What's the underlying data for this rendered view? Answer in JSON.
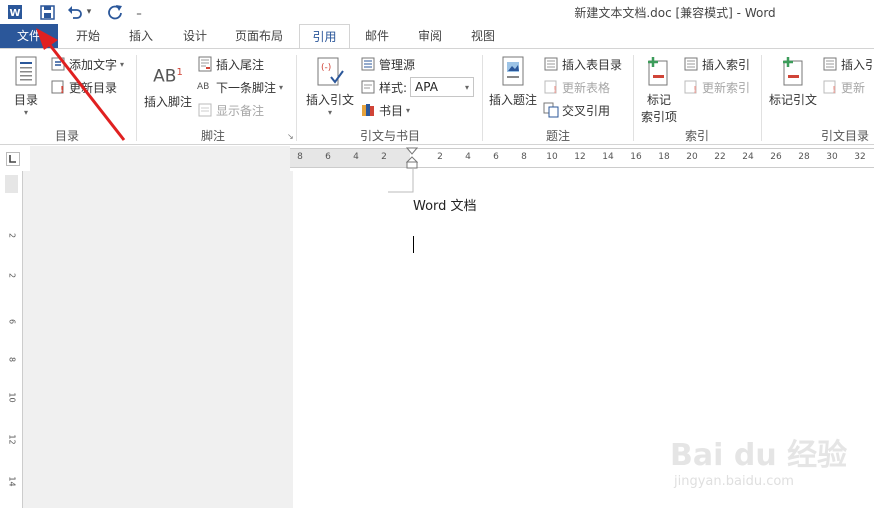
{
  "window": {
    "title": "新建文本文档.doc [兼容模式] - Word"
  },
  "qat": {
    "app_icon": "word-icon",
    "save_icon": "save-icon",
    "undo_icon": "undo-icon",
    "undo_caret": "▾",
    "redo_icon": "redo-icon",
    "customize": "₌"
  },
  "tabs": [
    {
      "label": "文件"
    },
    {
      "label": "开始"
    },
    {
      "label": "插入"
    },
    {
      "label": "设计"
    },
    {
      "label": "页面布局"
    },
    {
      "label": "引用"
    },
    {
      "label": "邮件"
    },
    {
      "label": "审阅"
    },
    {
      "label": "视图"
    }
  ],
  "ribbon": {
    "toc": {
      "big_label": "目录",
      "add_text": "添加文字",
      "update": "更新目录",
      "group": "目录"
    },
    "footnotes": {
      "big_label": "插入脚注",
      "big_glyph": "AB",
      "big_sup": "1",
      "endnote": "插入尾注",
      "next": "下一条脚注",
      "next_glyph": "AB",
      "show": "显示备注",
      "group": "脚注"
    },
    "citations": {
      "big_label": "插入引文",
      "manage": "管理源",
      "style_label": "样式:",
      "style_value": "APA",
      "bibliography": "书目",
      "group": "引文与书目"
    },
    "captions": {
      "big_label": "插入题注",
      "table_of_figures": "插入表目录",
      "update_table": "更新表格",
      "cross_ref": "交叉引用",
      "group": "题注"
    },
    "index": {
      "big_label_1": "标记",
      "big_label_2": "索引项",
      "insert_index": "插入索引",
      "update_index": "更新索引",
      "group": "索引"
    },
    "toa": {
      "big_label": "标记引文",
      "insert": "插入引",
      "update": "更新",
      "group": "引文目录"
    }
  },
  "ruler": {
    "ticks_left": [
      "8",
      "6",
      "4",
      "2"
    ],
    "ticks_right": [
      "2",
      "4",
      "6",
      "8",
      "10",
      "12",
      "14",
      "16",
      "18",
      "20",
      "22",
      "24",
      "26",
      "28",
      "30",
      "32"
    ],
    "vertical_ticks": [
      "2",
      "2",
      "4",
      "6",
      "8",
      "10",
      "12",
      "14"
    ]
  },
  "document": {
    "text": "Word 文档"
  },
  "colors": {
    "accent": "#2b579a",
    "annotation_arrow": "#e02020"
  },
  "watermark": {
    "brand": "Bai du 经验",
    "url": "jingyan.baidu.com"
  }
}
